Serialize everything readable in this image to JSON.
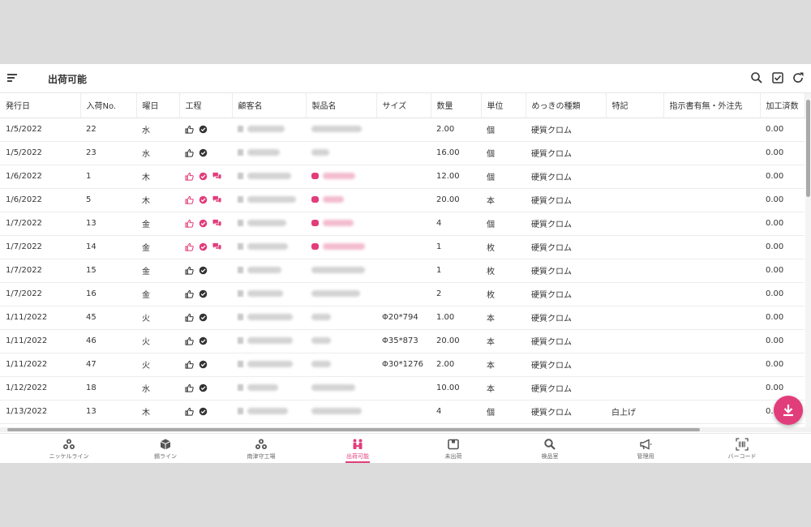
{
  "header": {
    "title": "出荷可能"
  },
  "columns": [
    "発行日",
    "入荷No.",
    "曜日",
    "工程",
    "顧客名",
    "製品名",
    "サイズ",
    "数量",
    "単位",
    "めっきの種類",
    "特記",
    "指示書有無・外注先",
    "加工済数"
  ],
  "rows": [
    {
      "date": "1/5/2022",
      "no": "22",
      "day": "水",
      "state": "normal",
      "customer": "",
      "product": "",
      "size": "",
      "qty": "2.00",
      "unit": "個",
      "plating": "硬質クロム",
      "note": "",
      "done": "0.00"
    },
    {
      "date": "1/5/2022",
      "no": "23",
      "day": "水",
      "state": "normal",
      "customer": "",
      "product": "",
      "size": "",
      "qty": "16.00",
      "unit": "個",
      "plating": "硬質クロム",
      "note": "",
      "done": "0.00"
    },
    {
      "date": "1/6/2022",
      "no": "1",
      "day": "木",
      "state": "flagged",
      "customer": "",
      "product": "",
      "size": "",
      "qty": "12.00",
      "unit": "個",
      "plating": "硬質クロム",
      "note": "",
      "done": "0.00"
    },
    {
      "date": "1/6/2022",
      "no": "5",
      "day": "木",
      "state": "flagged",
      "customer": "",
      "product": "",
      "size": "",
      "qty": "20.00",
      "unit": "本",
      "plating": "硬質クロム",
      "note": "",
      "done": "0.00"
    },
    {
      "date": "1/7/2022",
      "no": "13",
      "day": "金",
      "state": "flagged",
      "customer": "",
      "product": "",
      "size": "",
      "qty": "4",
      "unit": "個",
      "plating": "硬質クロム",
      "note": "",
      "done": "0.00"
    },
    {
      "date": "1/7/2022",
      "no": "14",
      "day": "金",
      "state": "flagged",
      "customer": "",
      "product": "",
      "size": "",
      "qty": "1",
      "unit": "枚",
      "plating": "硬質クロム",
      "note": "",
      "done": "0.00"
    },
    {
      "date": "1/7/2022",
      "no": "15",
      "day": "金",
      "state": "normal",
      "customer": "",
      "product": "",
      "size": "",
      "qty": "1",
      "unit": "枚",
      "plating": "硬質クロム",
      "note": "",
      "done": "0.00"
    },
    {
      "date": "1/7/2022",
      "no": "16",
      "day": "金",
      "state": "normal",
      "customer": "",
      "product": "",
      "size": "",
      "qty": "2",
      "unit": "枚",
      "plating": "硬質クロム",
      "note": "",
      "done": "0.00"
    },
    {
      "date": "1/11/2022",
      "no": "45",
      "day": "火",
      "state": "normal",
      "customer": "",
      "product": "",
      "size": "Φ20*794",
      "qty": "1.00",
      "unit": "本",
      "plating": "硬質クロム",
      "note": "",
      "done": "0.00"
    },
    {
      "date": "1/11/2022",
      "no": "46",
      "day": "火",
      "state": "normal",
      "customer": "",
      "product": "",
      "size": "Φ35*873",
      "qty": "20.00",
      "unit": "本",
      "plating": "硬質クロム",
      "note": "",
      "done": "0.00"
    },
    {
      "date": "1/11/2022",
      "no": "47",
      "day": "火",
      "state": "normal",
      "customer": "",
      "product": "",
      "size": "Φ30*1276",
      "qty": "2.00",
      "unit": "本",
      "plating": "硬質クロム",
      "note": "",
      "done": "0.00"
    },
    {
      "date": "1/12/2022",
      "no": "18",
      "day": "水",
      "state": "normal",
      "customer": "",
      "product": "",
      "size": "",
      "qty": "10.00",
      "unit": "本",
      "plating": "硬質クロム",
      "note": "",
      "done": "0.00"
    },
    {
      "date": "1/13/2022",
      "no": "13",
      "day": "木",
      "state": "normal",
      "customer": "",
      "product": "",
      "size": "",
      "qty": "4",
      "unit": "個",
      "plating": "硬質クロム",
      "note": "白上げ",
      "done": "0.00"
    }
  ],
  "nav": [
    {
      "label": "ニッケルライン",
      "icon": "molecule-icon"
    },
    {
      "label": "錫ライン",
      "icon": "cube-icon"
    },
    {
      "label": "南津守工場",
      "icon": "molecule-icon"
    },
    {
      "label": "出荷可能",
      "icon": "people-icon",
      "active": true
    },
    {
      "label": "未出荷",
      "icon": "box-icon"
    },
    {
      "label": "検品室",
      "icon": "search-icon"
    },
    {
      "label": "管理用",
      "icon": "megaphone-icon"
    },
    {
      "label": "バーコード",
      "icon": "barcode-icon"
    }
  ],
  "colors": {
    "accent": "#e23d7b",
    "icon": "#333333"
  }
}
